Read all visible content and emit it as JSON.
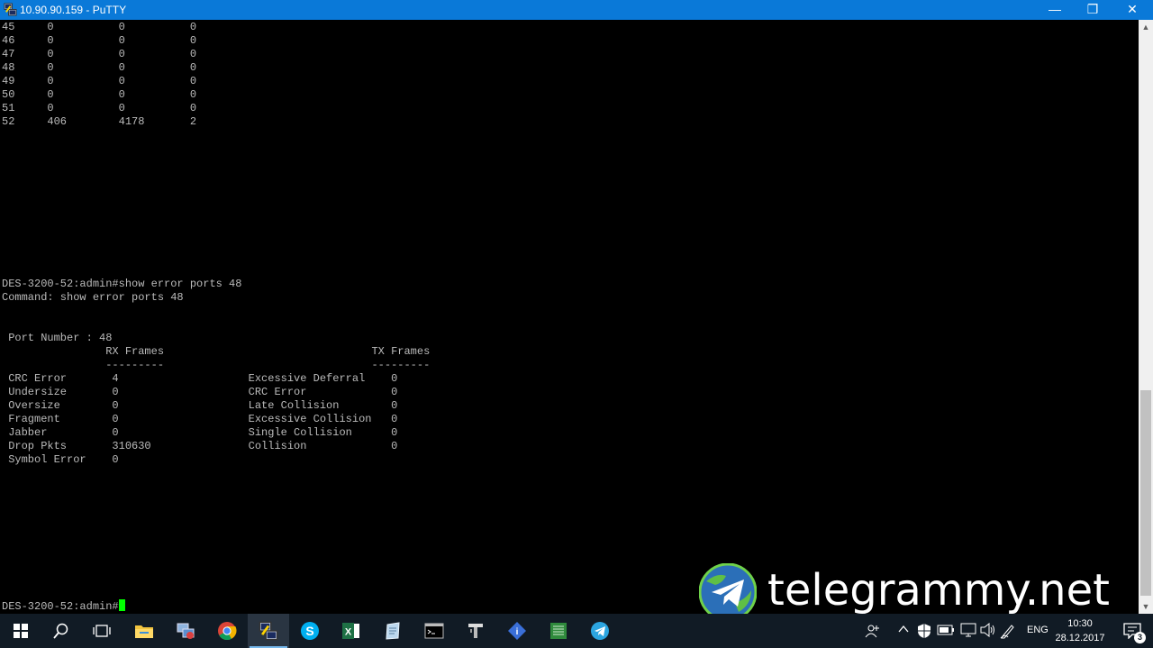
{
  "window": {
    "title": "10.90.90.159 - PuTTY",
    "minimize_glyph": "—",
    "maximize_glyph": "❐",
    "close_glyph": "✕"
  },
  "terminal": {
    "lines": [
      "45     0          0          0",
      "46     0          0          0",
      "47     0          0          0",
      "48     0          0          0",
      "49     0          0          0",
      "50     0          0          0",
      "51     0          0          0",
      "52     406        4178       2",
      "",
      "",
      "",
      "",
      "",
      "",
      "",
      "",
      "",
      "",
      "",
      "DES-3200-52:admin#show error ports 48",
      "Command: show error ports 48",
      "",
      "",
      " Port Number : 48",
      "                RX Frames                                TX Frames",
      "                ---------                                ---------",
      " CRC Error       4                    Excessive Deferral    0",
      " Undersize       0                    CRC Error             0",
      " Oversize        0                    Late Collision        0",
      " Fragment        0                    Excessive Collision   0",
      " Jabber          0                    Single Collision      0",
      " Drop Pkts       310630               Collision             0",
      " Symbol Error    0"
    ],
    "prompt": "DES-3200-52:admin#"
  },
  "watermark": {
    "text": "telegrammy.net"
  },
  "taskbar": {
    "apps": [
      {
        "name": "start-button",
        "icon": "windows-logo-icon"
      },
      {
        "name": "search-button",
        "icon": "search-icon"
      },
      {
        "name": "task-view-button",
        "icon": "task-view-icon"
      },
      {
        "name": "taskbar-file-explorer",
        "icon": "folder-icon"
      },
      {
        "name": "taskbar-network-app",
        "icon": "network-computer-icon"
      },
      {
        "name": "taskbar-chrome",
        "icon": "chrome-icon"
      },
      {
        "name": "taskbar-putty",
        "icon": "putty-icon",
        "active": true
      },
      {
        "name": "taskbar-skype",
        "icon": "skype-icon"
      },
      {
        "name": "taskbar-excel",
        "icon": "excel-icon"
      },
      {
        "name": "taskbar-notepad-app",
        "icon": "notepad-icon"
      },
      {
        "name": "taskbar-cmd",
        "icon": "command-prompt-icon"
      },
      {
        "name": "taskbar-tool-app",
        "icon": "tool-icon"
      },
      {
        "name": "taskbar-blue-app",
        "icon": "blue-diamond-icon"
      },
      {
        "name": "taskbar-sheet-app",
        "icon": "spreadsheet-icon"
      },
      {
        "name": "taskbar-telegram",
        "icon": "telegram-icon"
      }
    ],
    "language": "ENG",
    "time": "10:30",
    "date": "28.12.2017",
    "notification_count": "3"
  },
  "colors": {
    "titlebar": "#0a79d8",
    "terminal_text": "#bbbbbb",
    "cursor": "#00ff00",
    "taskbar": "#111b25"
  }
}
